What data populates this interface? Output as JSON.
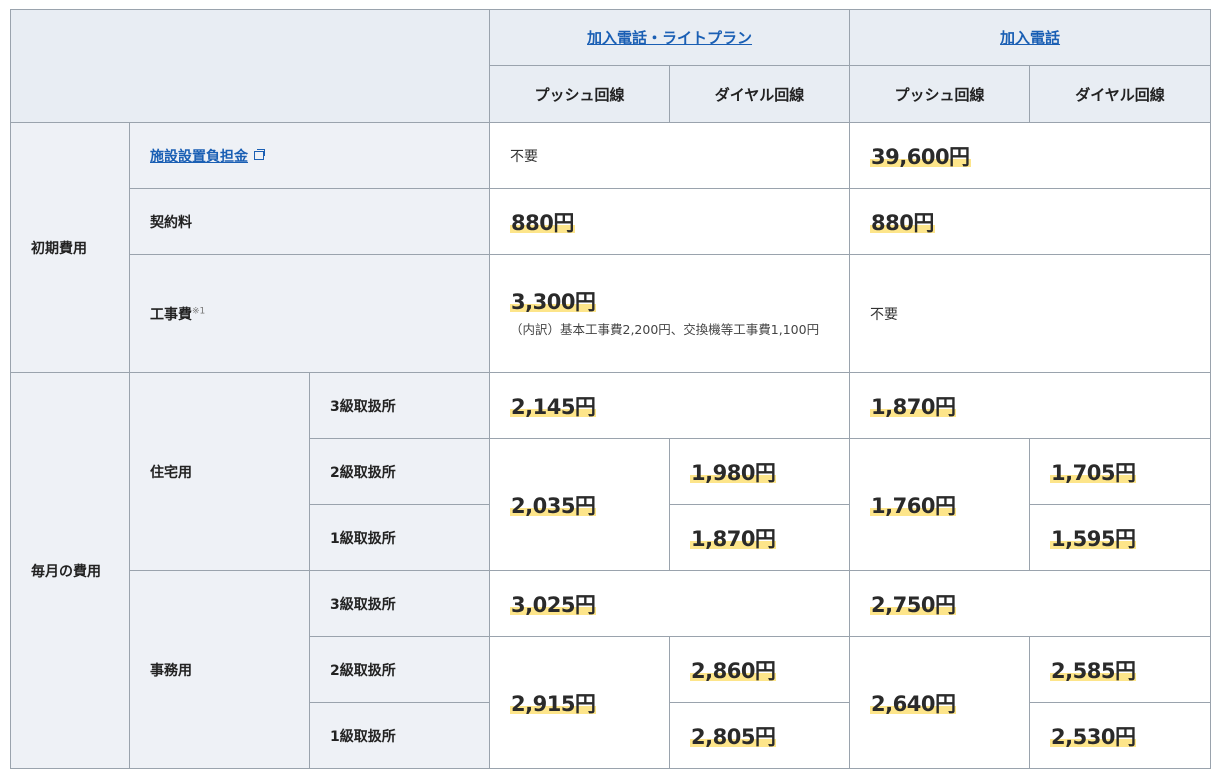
{
  "header": {
    "plan_light": "加入電話・ライトプラン",
    "plan_std": "加入電話",
    "push": "プッシュ回線",
    "dial": "ダイヤル回線"
  },
  "initial": {
    "group": "初期費用",
    "facility": {
      "label": "施設設置負担金",
      "light": "不要",
      "std": "39,600円"
    },
    "contract": {
      "label": "契約料",
      "light": "880円",
      "std": "880円"
    },
    "work": {
      "label": "工事費",
      "note_mark": "※1",
      "light": "3,300円",
      "light_note": "（内訳）基本工事費2,200円、交換機等工事費1,100円",
      "std": "不要"
    }
  },
  "monthly": {
    "group": "毎月の費用",
    "residential": {
      "label": "住宅用",
      "class3": {
        "label": "3級取扱所",
        "light": "2,145円",
        "std": "1,870円"
      },
      "class2": {
        "label": "2級取扱所",
        "light_dial": "1,980円",
        "std_dial": "1,705円"
      },
      "class1": {
        "label": "1級取扱所",
        "light_dial": "1,870円",
        "std_dial": "1,595円"
      },
      "light_push": "2,035円",
      "std_push": "1,760円"
    },
    "business": {
      "label": "事務用",
      "class3": {
        "label": "3級取扱所",
        "light": "3,025円",
        "std": "2,750円"
      },
      "class2": {
        "label": "2級取扱所",
        "light_dial": "2,860円",
        "std_dial": "2,585円"
      },
      "class1": {
        "label": "1級取扱所",
        "light_dial": "2,805円",
        "std_dial": "2,530円"
      },
      "light_push": "2,915円",
      "std_push": "2,640円"
    }
  }
}
